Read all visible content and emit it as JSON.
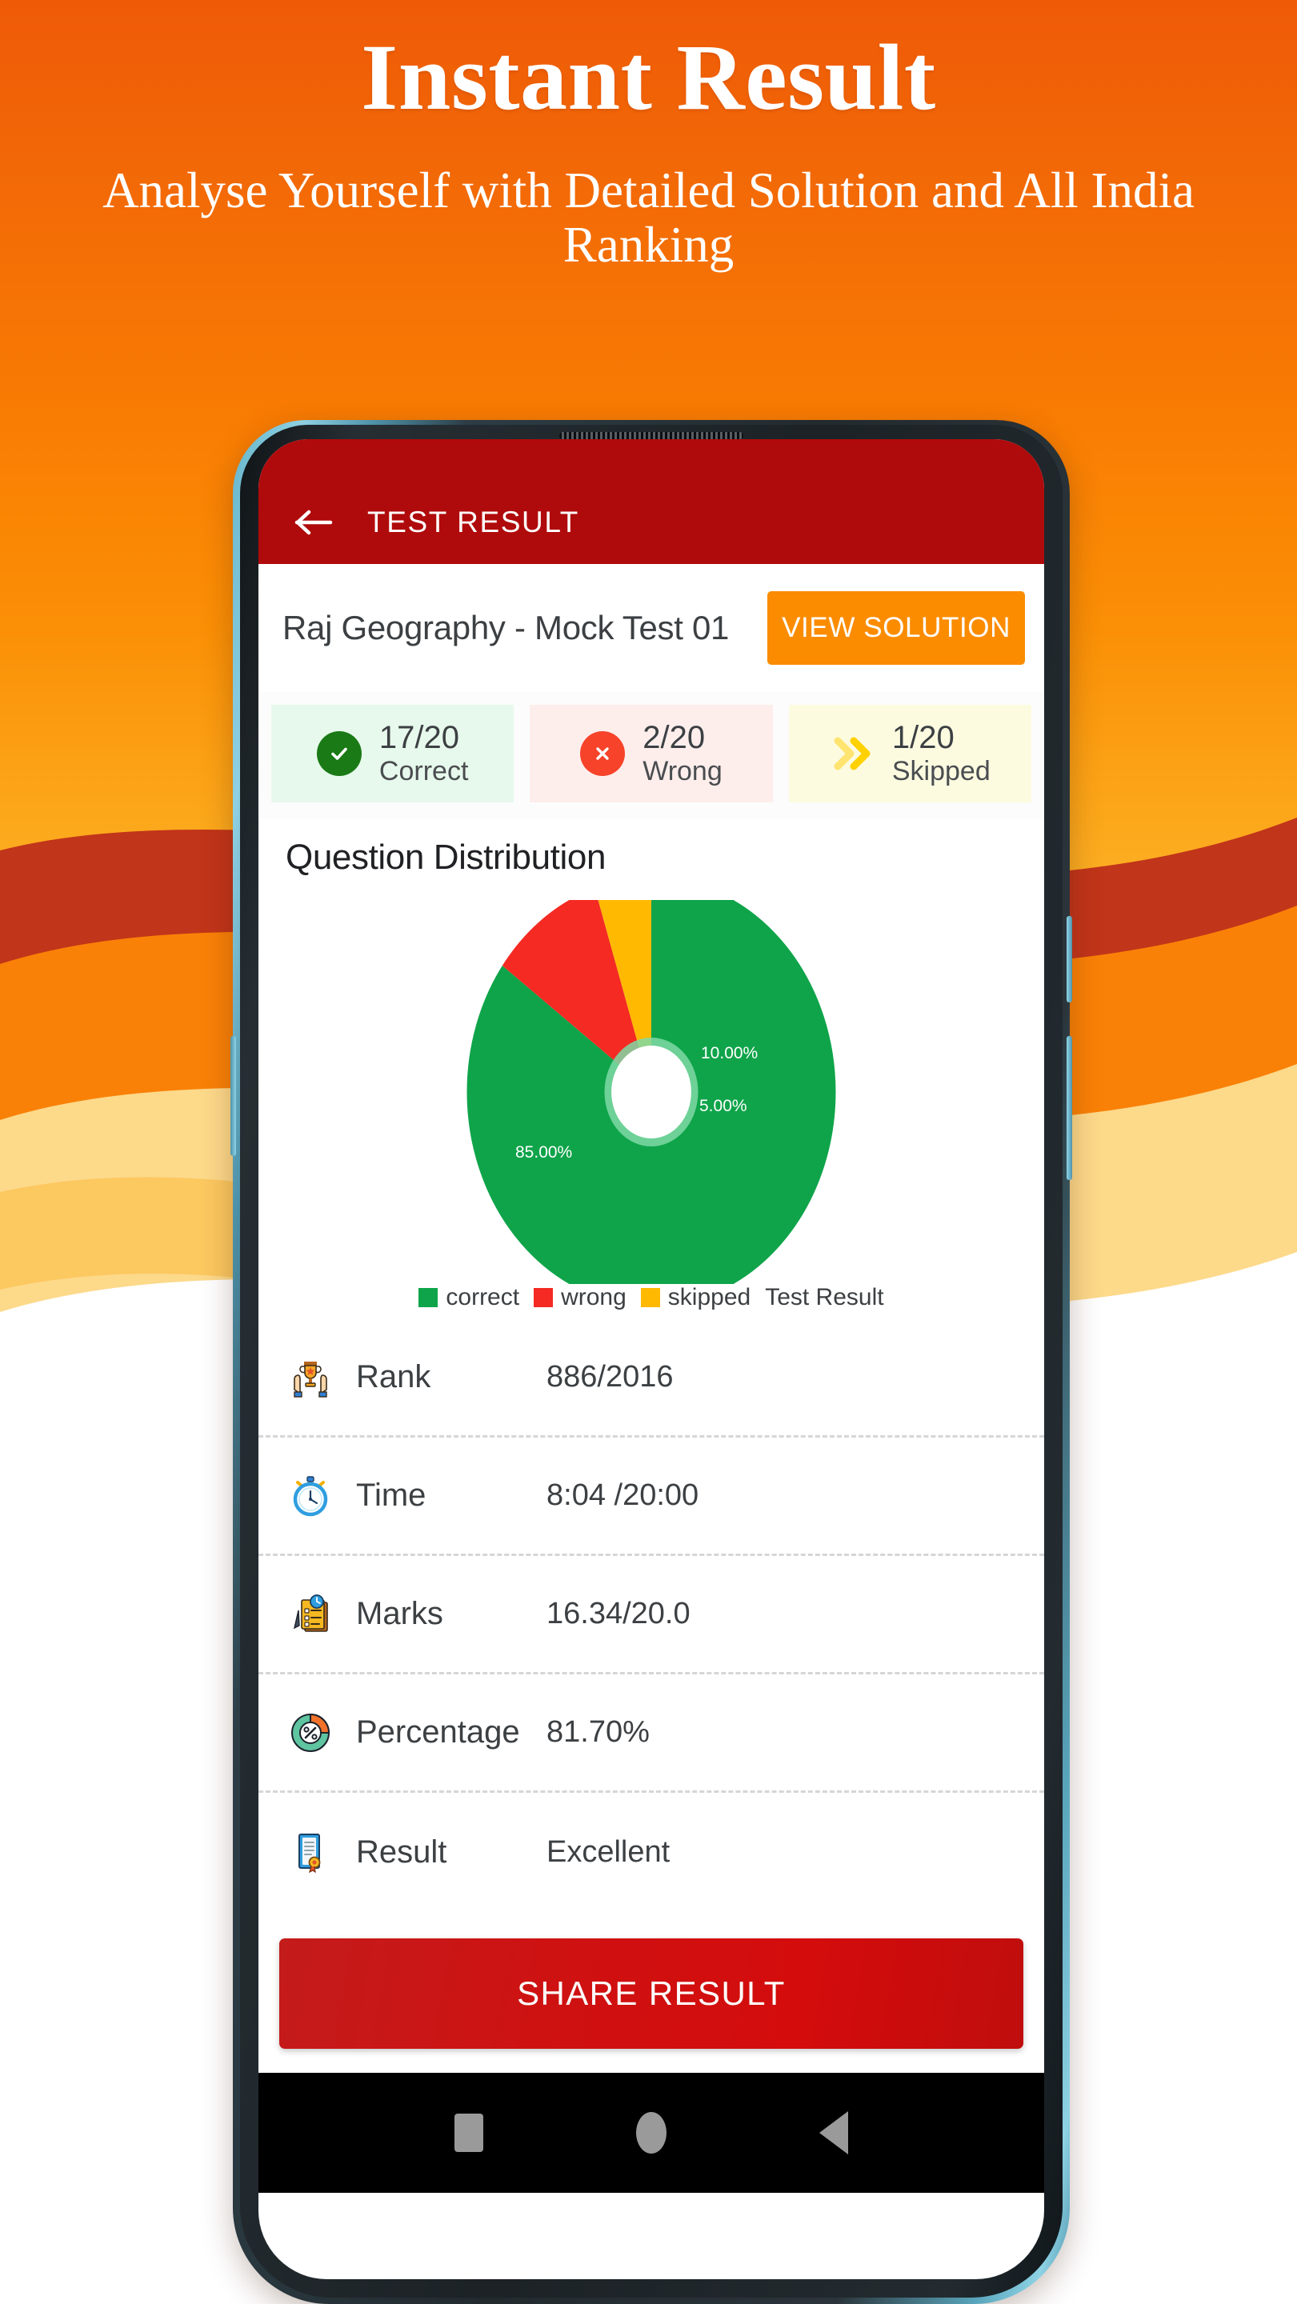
{
  "promo": {
    "title": "Instant Result",
    "subtitle": "Analyse Yourself with Detailed Solution and All India Ranking",
    "bg_color_top": "#ef5a07",
    "bg_color_bottom": "#fdb42a",
    "wave_colors": [
      "#c1351a",
      "#f98107",
      "#fcb33f",
      "#fdd98a"
    ]
  },
  "app": {
    "appbar": {
      "title": "TEST RESULT",
      "back_icon": "arrow-left-icon",
      "bg_color": "#b00b0c"
    },
    "test": {
      "name": "Raj Geography - Mock Test 01",
      "view_solution_label": "VIEW SOLUTION",
      "view_solution_color": "#fb8c00"
    },
    "stat_cards": [
      {
        "count": "17/20",
        "label": "Correct",
        "icon": "check-circle-icon",
        "bg": "#e7f9ec",
        "accent": "#1a7a15"
      },
      {
        "count": "2/20",
        "label": "Wrong",
        "icon": "x-circle-icon",
        "bg": "#fdeeec",
        "accent": "#f6432a"
      },
      {
        "count": "1/20",
        "label": "Skipped",
        "icon": "double-chevron-right-icon",
        "bg": "#fcfbe0",
        "accent": "#ffd400"
      }
    ],
    "question_distribution": {
      "title": "Question Distribution"
    },
    "stats_rows": [
      {
        "icon": "trophy-hands-icon",
        "label": "Rank",
        "value": "886/2016"
      },
      {
        "icon": "stopwatch-icon",
        "label": "Time",
        "value": "8:04 /20:00"
      },
      {
        "icon": "clipboard-timer-icon",
        "label": "Marks",
        "value": "16.34/20.0"
      },
      {
        "icon": "percent-donut-icon",
        "label": "Percentage",
        "value": "81.70%"
      },
      {
        "icon": "certificate-icon",
        "label": "Result",
        "value": "Excellent"
      }
    ],
    "share": {
      "label": "SHARE RESULT",
      "color": "#cf1111"
    },
    "navbar": {
      "recent_icon": "square-icon",
      "home_icon": "circle-icon",
      "back_icon": "triangle-left-icon"
    }
  },
  "chart_data": {
    "type": "pie",
    "title": "Question Distribution",
    "donut": true,
    "categories": [
      "correct",
      "wrong",
      "skipped"
    ],
    "values": [
      85.0,
      10.0,
      5.0
    ],
    "value_labels": [
      "85.00%",
      "10.00%",
      "5.00%"
    ],
    "colors": [
      "#0fa44a",
      "#f42a23",
      "#ffb900"
    ],
    "legend": [
      "correct",
      "wrong",
      "skipped"
    ],
    "legend_suffix": "Test Result",
    "legend_position": "bottom",
    "start_angle_deg": 0,
    "units": "percent"
  }
}
